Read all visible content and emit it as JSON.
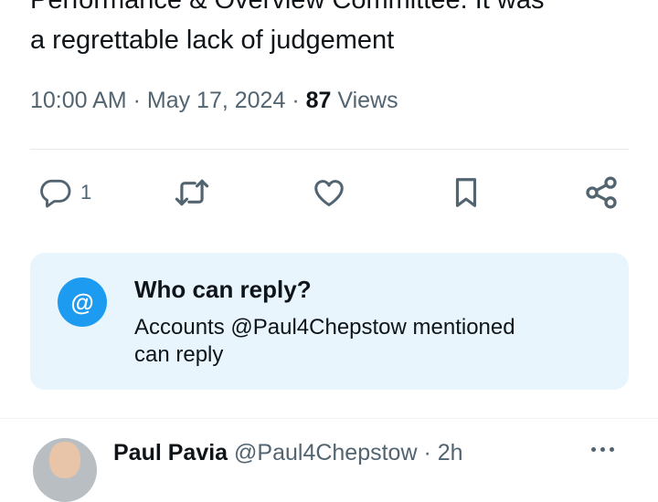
{
  "tweet": {
    "text_line_1": "Performance & Overview Committee. It was",
    "text_line_2": "a regrettable lack of judgement",
    "time": "10:00 AM",
    "separator": "·",
    "date": "May 17, 2024",
    "views_count": "87",
    "views_label": "Views"
  },
  "actions": {
    "reply_count": "1",
    "icons": [
      "reply-icon",
      "repost-icon",
      "like-icon",
      "bookmark-icon",
      "share-icon"
    ]
  },
  "who_can_reply": {
    "icon_glyph": "@",
    "title": "Who can reply?",
    "description_line_1": "Accounts @Paul4Chepstow mentioned",
    "description_line_2": "can reply"
  },
  "next_post": {
    "name": "Paul Pavia",
    "handle": "@Paul4Chepstow",
    "separator": "·",
    "time": "2h"
  },
  "colors": {
    "accent": "#1d9bf0",
    "reply_box_bg": "#e8f5fd",
    "secondary_text": "#536471",
    "primary_text": "#0f1419"
  }
}
